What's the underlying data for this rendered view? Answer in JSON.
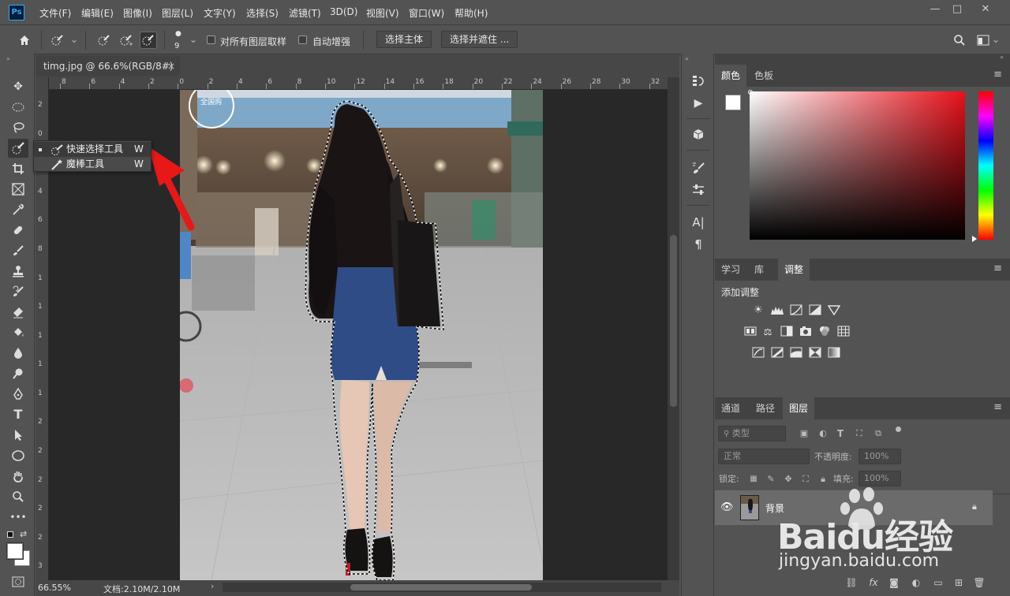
{
  "app": {
    "logo": "Ps"
  },
  "menu": [
    "文件(F)",
    "编辑(E)",
    "图像(I)",
    "图层(L)",
    "文字(Y)",
    "选择(S)",
    "滤镜(T)",
    "3D(D)",
    "视图(V)",
    "窗口(W)",
    "帮助(H)"
  ],
  "window_controls": {
    "minimize": "—",
    "restore": "□",
    "close": "✕"
  },
  "options": {
    "brush_size": "9",
    "sample_all_layers": "对所有图层取样",
    "auto_enhance": "自动增强",
    "select_subject": "选择主体",
    "select_and_mask": "选择并遮住 ..."
  },
  "document": {
    "tab_title": "timg.jpg @ 66.6%(RGB/8#)",
    "tab_close": "×",
    "zoom": "66.55%",
    "doc_size": "文档:2.10M/2.10M",
    "ruler_top": [
      "8",
      "6",
      "4",
      "2",
      "0",
      "2",
      "4",
      "6",
      "8",
      "10",
      "12",
      "14",
      "16",
      "18",
      "20",
      "22",
      "24",
      "26",
      "28",
      "30",
      "32"
    ],
    "ruler_left": [
      "2",
      "0",
      "2",
      "4",
      "6",
      "8",
      "1",
      "1",
      "1",
      "1",
      "1",
      "2",
      "2",
      "2",
      "2",
      "2",
      "3"
    ]
  },
  "flyout": {
    "items": [
      {
        "label": "快速选择工具",
        "key": "W"
      },
      {
        "label": "魔棒工具",
        "key": "W"
      }
    ]
  },
  "color_panel": {
    "tabs": [
      "颜色",
      "色板"
    ],
    "hue_color": "#e8101a"
  },
  "adjust_panel": {
    "tabs": [
      "学习",
      "库",
      "调整"
    ],
    "title": "添加调整"
  },
  "layers_panel": {
    "tabs": [
      "通道",
      "路径",
      "图层"
    ],
    "filter_placeholder": "类型",
    "blend_mode": "正常",
    "opacity_label": "不透明度:",
    "opacity_value": "100%",
    "lock_label": "锁定:",
    "fill_label": "填充:",
    "fill_value": "100%",
    "layer_name": "背景"
  },
  "watermark": {
    "brand": "Baidu经验",
    "url": "jingyan.baidu.com"
  },
  "photo_stamp": "全国购"
}
